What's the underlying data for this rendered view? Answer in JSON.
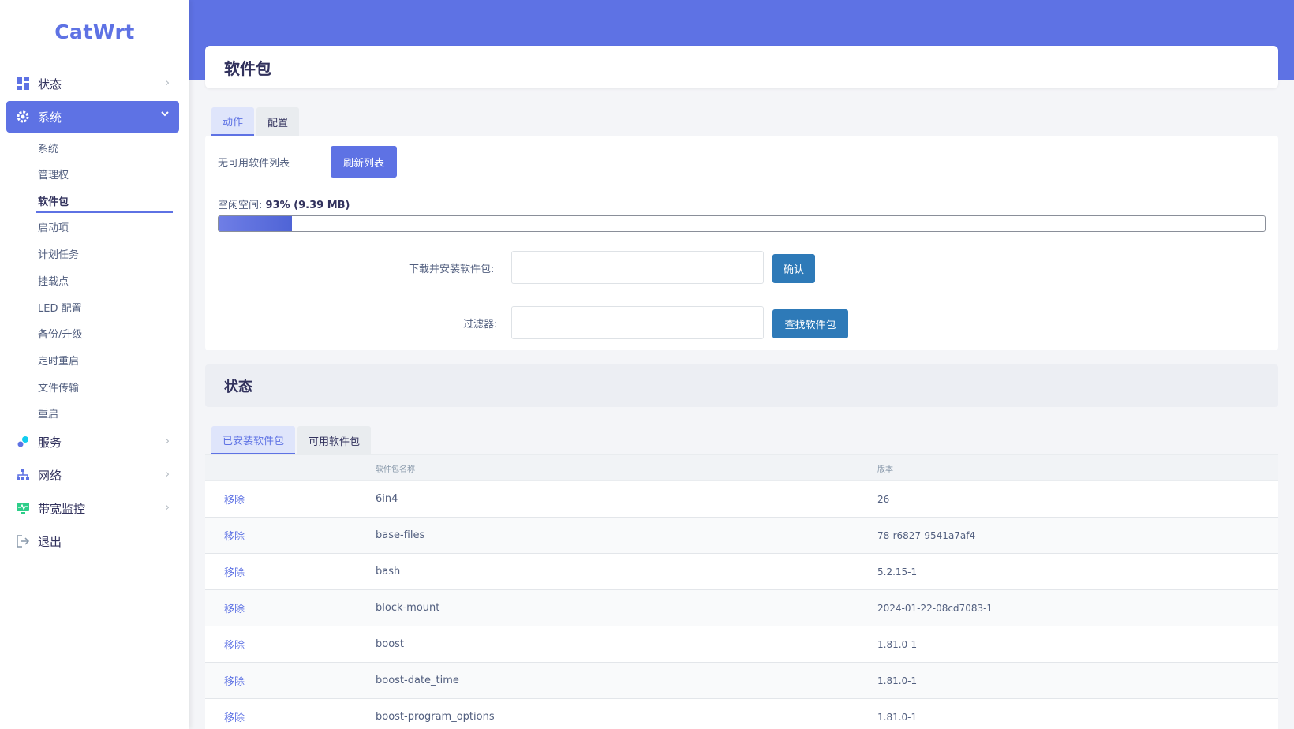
{
  "brand": "CatWrt",
  "menu": {
    "status": "状态",
    "system": "系统",
    "services": "服务",
    "network": "网络",
    "bandwidth": "带宽监控",
    "logout": "退出"
  },
  "submenu": [
    "系统",
    "管理权",
    "软件包",
    "启动项",
    "计划任务",
    "挂载点",
    "LED 配置",
    "备份/升级",
    "定时重启",
    "文件传输",
    "重启"
  ],
  "page_title": "软件包",
  "action_tabs": [
    "动作",
    "配置"
  ],
  "no_list_text": "无可用软件列表",
  "refresh_button": "刷新列表",
  "free_space": {
    "label": "空闲空间: ",
    "value": "93% (9.39 MB)",
    "used_fraction": 0.07
  },
  "download": {
    "label": "下载并安装软件包:",
    "value": "",
    "button": "确认"
  },
  "filter": {
    "label": "过滤器:",
    "value": "",
    "button": "查找软件包"
  },
  "status_title": "状态",
  "pkg_tabs": [
    "已安装软件包",
    "可用软件包"
  ],
  "table": {
    "headers": [
      "",
      "软件包名称",
      "版本"
    ],
    "action_label": "移除",
    "rows": [
      {
        "name": "6in4",
        "version": "26"
      },
      {
        "name": "base-files",
        "version": "78-r6827-9541a7af4"
      },
      {
        "name": "bash",
        "version": "5.2.15-1"
      },
      {
        "name": "block-mount",
        "version": "2024-01-22-08cd7083-1"
      },
      {
        "name": "boost",
        "version": "1.81.0-1"
      },
      {
        "name": "boost-date_time",
        "version": "1.81.0-1"
      },
      {
        "name": "boost-program_options",
        "version": "1.81.0-1"
      }
    ]
  },
  "colors": {
    "accent": "#5e72e4",
    "button_blue": "#2e7ab8"
  }
}
